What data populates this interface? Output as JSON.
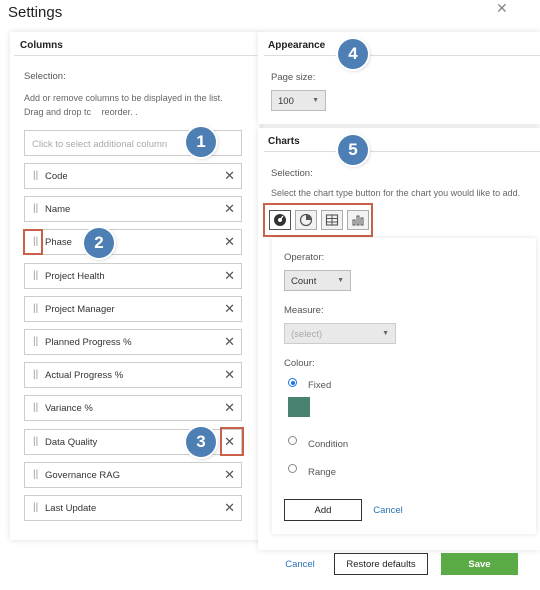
{
  "dialog": {
    "title": "Settings",
    "close_glyph": "✕"
  },
  "columns": {
    "header": "Columns",
    "selection_label": "Selection:",
    "desc_line1": "Add or remove columns to be displayed in the list.",
    "desc_line2": "Drag and drop tc",
    "desc_line3": "reorder.  .",
    "search_placeholder": "Click to select additional column",
    "items": [
      {
        "label": "Code"
      },
      {
        "label": "Name"
      },
      {
        "label": "Phase"
      },
      {
        "label": "Project Health"
      },
      {
        "label": "Project Manager"
      },
      {
        "label": "Planned Progress %"
      },
      {
        "label": "Actual Progress %"
      },
      {
        "label": "Variance %"
      },
      {
        "label": "Data Quality"
      },
      {
        "label": "Governance RAG"
      },
      {
        "label": "Last Update"
      }
    ],
    "drag_glyph": "||",
    "remove_glyph": "✕"
  },
  "appearance": {
    "header": "Appearance",
    "page_size_label": "Page size:",
    "page_size_value": "100"
  },
  "charts": {
    "header": "Charts",
    "selection_label": "Selection:",
    "desc": "Select the chart type button for the chart you would like to add.",
    "operator_label": "Operator:",
    "operator_value": "Count",
    "measure_label": "Measure:",
    "measure_value": "(select)",
    "colour_label": "Colour:",
    "colour_options": [
      "Fixed",
      "Condition",
      "Range"
    ],
    "fixed_color": "#4a8272",
    "add_label": "Add",
    "cancel_label": "Cancel"
  },
  "footer": {
    "cancel_label": "Cancel",
    "restore_label": "Restore defaults",
    "save_label": "Save"
  },
  "callouts": [
    "1",
    "2",
    "3",
    "4",
    "5"
  ],
  "colors": {
    "accent": "#2a72b5",
    "save": "#5aaa46",
    "callout": "#4d7fb5",
    "highlight": "#c9604a"
  }
}
